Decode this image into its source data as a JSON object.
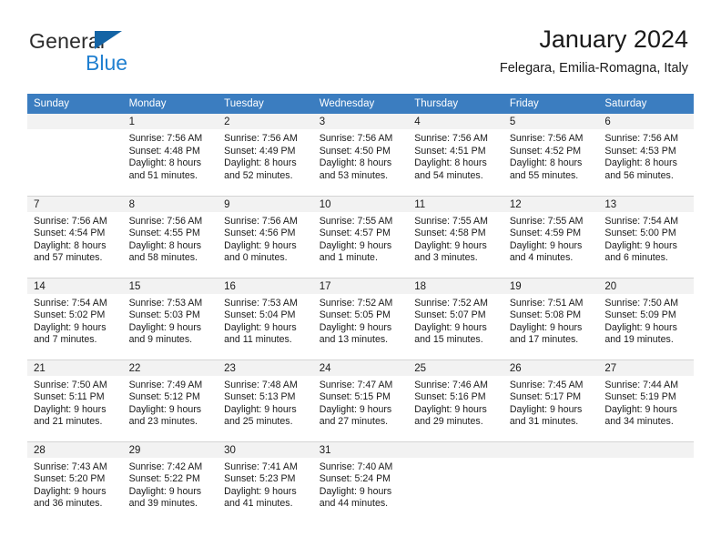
{
  "brand": {
    "name_part1": "General",
    "name_part2": "Blue",
    "triangle_color": "#1464a5",
    "blue_color": "#1f7fd0"
  },
  "header": {
    "title": "January 2024",
    "subtitle": "Felegara, Emilia-Romagna, Italy"
  },
  "colors": {
    "header_row": "#3b7dc0",
    "daynum_band": "#f2f2f2",
    "cell_border": "#d4d4d4"
  },
  "weekdays": [
    "Sunday",
    "Monday",
    "Tuesday",
    "Wednesday",
    "Thursday",
    "Friday",
    "Saturday"
  ],
  "weeks": [
    [
      {
        "day": "",
        "sunrise": "",
        "sunset": "",
        "daylight1": "",
        "daylight2": ""
      },
      {
        "day": "1",
        "sunrise": "Sunrise: 7:56 AM",
        "sunset": "Sunset: 4:48 PM",
        "daylight1": "Daylight: 8 hours",
        "daylight2": "and 51 minutes."
      },
      {
        "day": "2",
        "sunrise": "Sunrise: 7:56 AM",
        "sunset": "Sunset: 4:49 PM",
        "daylight1": "Daylight: 8 hours",
        "daylight2": "and 52 minutes."
      },
      {
        "day": "3",
        "sunrise": "Sunrise: 7:56 AM",
        "sunset": "Sunset: 4:50 PM",
        "daylight1": "Daylight: 8 hours",
        "daylight2": "and 53 minutes."
      },
      {
        "day": "4",
        "sunrise": "Sunrise: 7:56 AM",
        "sunset": "Sunset: 4:51 PM",
        "daylight1": "Daylight: 8 hours",
        "daylight2": "and 54 minutes."
      },
      {
        "day": "5",
        "sunrise": "Sunrise: 7:56 AM",
        "sunset": "Sunset: 4:52 PM",
        "daylight1": "Daylight: 8 hours",
        "daylight2": "and 55 minutes."
      },
      {
        "day": "6",
        "sunrise": "Sunrise: 7:56 AM",
        "sunset": "Sunset: 4:53 PM",
        "daylight1": "Daylight: 8 hours",
        "daylight2": "and 56 minutes."
      }
    ],
    [
      {
        "day": "7",
        "sunrise": "Sunrise: 7:56 AM",
        "sunset": "Sunset: 4:54 PM",
        "daylight1": "Daylight: 8 hours",
        "daylight2": "and 57 minutes."
      },
      {
        "day": "8",
        "sunrise": "Sunrise: 7:56 AM",
        "sunset": "Sunset: 4:55 PM",
        "daylight1": "Daylight: 8 hours",
        "daylight2": "and 58 minutes."
      },
      {
        "day": "9",
        "sunrise": "Sunrise: 7:56 AM",
        "sunset": "Sunset: 4:56 PM",
        "daylight1": "Daylight: 9 hours",
        "daylight2": "and 0 minutes."
      },
      {
        "day": "10",
        "sunrise": "Sunrise: 7:55 AM",
        "sunset": "Sunset: 4:57 PM",
        "daylight1": "Daylight: 9 hours",
        "daylight2": "and 1 minute."
      },
      {
        "day": "11",
        "sunrise": "Sunrise: 7:55 AM",
        "sunset": "Sunset: 4:58 PM",
        "daylight1": "Daylight: 9 hours",
        "daylight2": "and 3 minutes."
      },
      {
        "day": "12",
        "sunrise": "Sunrise: 7:55 AM",
        "sunset": "Sunset: 4:59 PM",
        "daylight1": "Daylight: 9 hours",
        "daylight2": "and 4 minutes."
      },
      {
        "day": "13",
        "sunrise": "Sunrise: 7:54 AM",
        "sunset": "Sunset: 5:00 PM",
        "daylight1": "Daylight: 9 hours",
        "daylight2": "and 6 minutes."
      }
    ],
    [
      {
        "day": "14",
        "sunrise": "Sunrise: 7:54 AM",
        "sunset": "Sunset: 5:02 PM",
        "daylight1": "Daylight: 9 hours",
        "daylight2": "and 7 minutes."
      },
      {
        "day": "15",
        "sunrise": "Sunrise: 7:53 AM",
        "sunset": "Sunset: 5:03 PM",
        "daylight1": "Daylight: 9 hours",
        "daylight2": "and 9 minutes."
      },
      {
        "day": "16",
        "sunrise": "Sunrise: 7:53 AM",
        "sunset": "Sunset: 5:04 PM",
        "daylight1": "Daylight: 9 hours",
        "daylight2": "and 11 minutes."
      },
      {
        "day": "17",
        "sunrise": "Sunrise: 7:52 AM",
        "sunset": "Sunset: 5:05 PM",
        "daylight1": "Daylight: 9 hours",
        "daylight2": "and 13 minutes."
      },
      {
        "day": "18",
        "sunrise": "Sunrise: 7:52 AM",
        "sunset": "Sunset: 5:07 PM",
        "daylight1": "Daylight: 9 hours",
        "daylight2": "and 15 minutes."
      },
      {
        "day": "19",
        "sunrise": "Sunrise: 7:51 AM",
        "sunset": "Sunset: 5:08 PM",
        "daylight1": "Daylight: 9 hours",
        "daylight2": "and 17 minutes."
      },
      {
        "day": "20",
        "sunrise": "Sunrise: 7:50 AM",
        "sunset": "Sunset: 5:09 PM",
        "daylight1": "Daylight: 9 hours",
        "daylight2": "and 19 minutes."
      }
    ],
    [
      {
        "day": "21",
        "sunrise": "Sunrise: 7:50 AM",
        "sunset": "Sunset: 5:11 PM",
        "daylight1": "Daylight: 9 hours",
        "daylight2": "and 21 minutes."
      },
      {
        "day": "22",
        "sunrise": "Sunrise: 7:49 AM",
        "sunset": "Sunset: 5:12 PM",
        "daylight1": "Daylight: 9 hours",
        "daylight2": "and 23 minutes."
      },
      {
        "day": "23",
        "sunrise": "Sunrise: 7:48 AM",
        "sunset": "Sunset: 5:13 PM",
        "daylight1": "Daylight: 9 hours",
        "daylight2": "and 25 minutes."
      },
      {
        "day": "24",
        "sunrise": "Sunrise: 7:47 AM",
        "sunset": "Sunset: 5:15 PM",
        "daylight1": "Daylight: 9 hours",
        "daylight2": "and 27 minutes."
      },
      {
        "day": "25",
        "sunrise": "Sunrise: 7:46 AM",
        "sunset": "Sunset: 5:16 PM",
        "daylight1": "Daylight: 9 hours",
        "daylight2": "and 29 minutes."
      },
      {
        "day": "26",
        "sunrise": "Sunrise: 7:45 AM",
        "sunset": "Sunset: 5:17 PM",
        "daylight1": "Daylight: 9 hours",
        "daylight2": "and 31 minutes."
      },
      {
        "day": "27",
        "sunrise": "Sunrise: 7:44 AM",
        "sunset": "Sunset: 5:19 PM",
        "daylight1": "Daylight: 9 hours",
        "daylight2": "and 34 minutes."
      }
    ],
    [
      {
        "day": "28",
        "sunrise": "Sunrise: 7:43 AM",
        "sunset": "Sunset: 5:20 PM",
        "daylight1": "Daylight: 9 hours",
        "daylight2": "and 36 minutes."
      },
      {
        "day": "29",
        "sunrise": "Sunrise: 7:42 AM",
        "sunset": "Sunset: 5:22 PM",
        "daylight1": "Daylight: 9 hours",
        "daylight2": "and 39 minutes."
      },
      {
        "day": "30",
        "sunrise": "Sunrise: 7:41 AM",
        "sunset": "Sunset: 5:23 PM",
        "daylight1": "Daylight: 9 hours",
        "daylight2": "and 41 minutes."
      },
      {
        "day": "31",
        "sunrise": "Sunrise: 7:40 AM",
        "sunset": "Sunset: 5:24 PM",
        "daylight1": "Daylight: 9 hours",
        "daylight2": "and 44 minutes."
      },
      {
        "day": "",
        "sunrise": "",
        "sunset": "",
        "daylight1": "",
        "daylight2": ""
      },
      {
        "day": "",
        "sunrise": "",
        "sunset": "",
        "daylight1": "",
        "daylight2": ""
      },
      {
        "day": "",
        "sunrise": "",
        "sunset": "",
        "daylight1": "",
        "daylight2": ""
      }
    ]
  ]
}
